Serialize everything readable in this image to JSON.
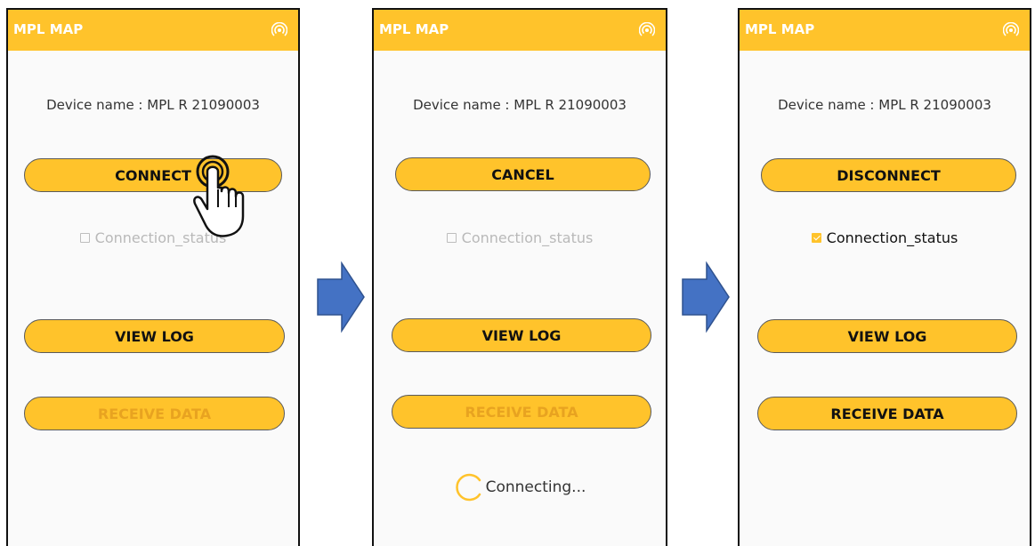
{
  "colors": {
    "accent": "#ffc32b",
    "arrow": "#4472c4"
  },
  "screens": [
    {
      "app_title": "MPL MAP",
      "device_name": "Device name : MPL R 21090003",
      "primary_button": "CONNECT",
      "status_label": "Connection_status",
      "status_checked": false,
      "view_log": "VIEW LOG",
      "receive_data": "RECEIVE DATA",
      "receive_enabled": false
    },
    {
      "app_title": "MPL MAP",
      "device_name": "Device name : MPL R 21090003",
      "primary_button": "CANCEL",
      "status_label": "Connection_status",
      "status_checked": false,
      "view_log": "VIEW LOG",
      "receive_data": "RECEIVE DATA",
      "receive_enabled": false,
      "progress_text": "Connecting..."
    },
    {
      "app_title": "MPL MAP",
      "device_name": "Device name : MPL R 21090003",
      "primary_button": "DISCONNECT",
      "status_label": "Connection_status",
      "status_checked": true,
      "view_log": "VIEW LOG",
      "receive_data": "RECEIVE DATA",
      "receive_enabled": true
    }
  ],
  "icons": [
    "wifi-icon",
    "tap-hand-icon",
    "right-arrow-icon",
    "loading-spinner-icon",
    "checkbox-icon"
  ]
}
